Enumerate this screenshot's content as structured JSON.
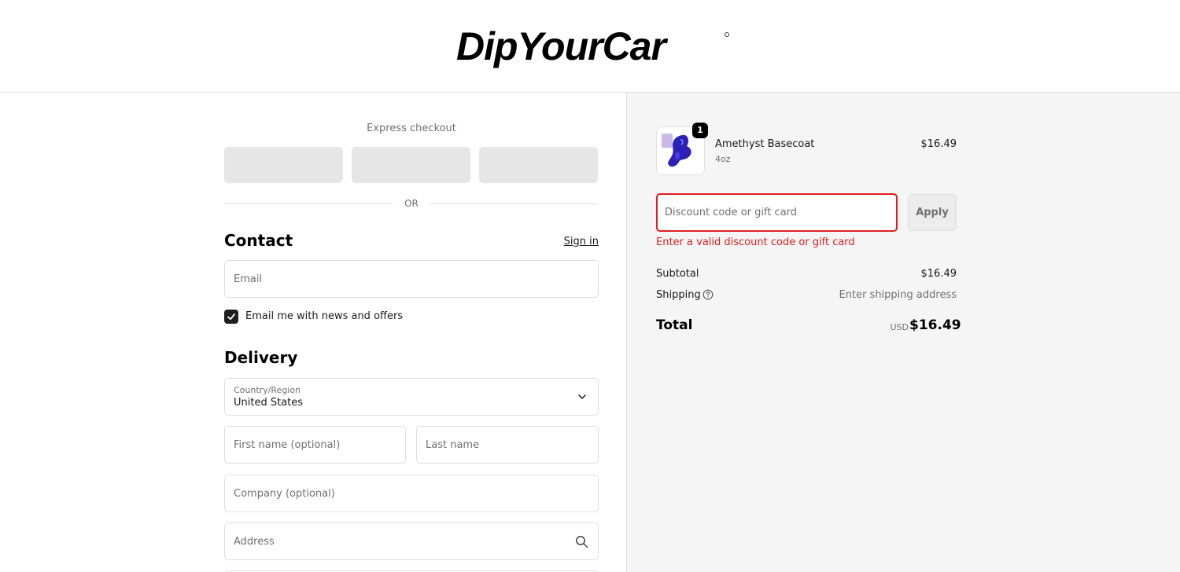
{
  "brand": {
    "logo_text": "DipYourCar"
  },
  "express": {
    "title": "Express checkout",
    "buttons": [
      "",
      "",
      ""
    ],
    "or_label": "OR"
  },
  "contact": {
    "title": "Contact",
    "sign_in_label": "Sign in",
    "email_placeholder": "Email",
    "newsletter_label": "Email me with news and offers",
    "newsletter_checked": true
  },
  "delivery": {
    "title": "Delivery",
    "country_label": "Country/Region",
    "country_value": "United States",
    "first_name_placeholder": "First name (optional)",
    "last_name_placeholder": "Last name",
    "company_placeholder": "Company (optional)",
    "address_placeholder": "Address"
  },
  "order": {
    "item": {
      "name": "Amethyst Basecoat",
      "variant": "4oz",
      "price": "$16.49",
      "quantity": "1"
    },
    "discount_placeholder": "Discount code or gift card",
    "apply_label": "Apply",
    "discount_error": "Enter a valid discount code or gift card",
    "subtotal_label": "Subtotal",
    "subtotal_value": "$16.49",
    "shipping_label": "Shipping",
    "shipping_value": "Enter shipping address",
    "total_label": "Total",
    "currency": "USD",
    "total_value": "$16.49"
  },
  "colors": {
    "error": "#dd1d1d",
    "panel_bg": "#f5f5f5",
    "border": "#dedede",
    "product": "#2b20b8"
  }
}
